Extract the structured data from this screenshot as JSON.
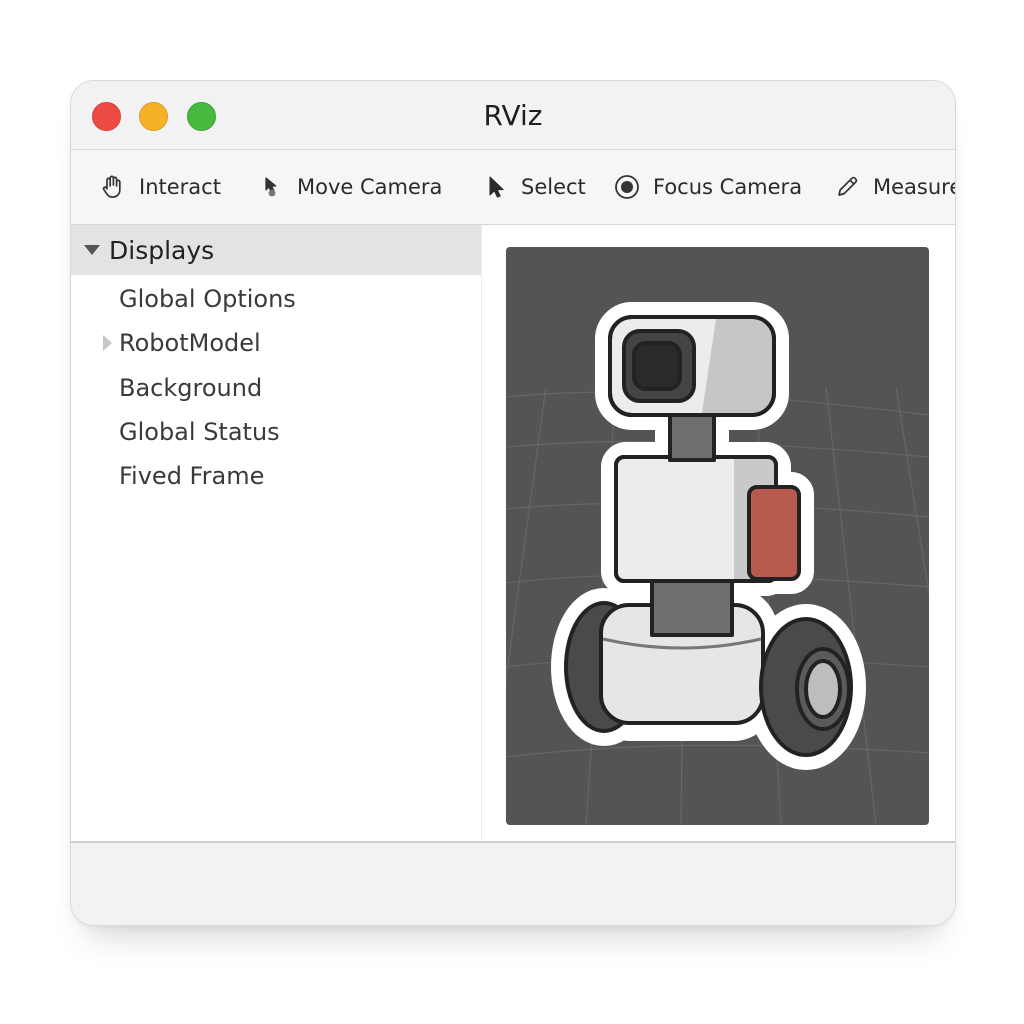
{
  "window": {
    "title": "RViz"
  },
  "toolbar": {
    "tools": [
      {
        "label": "Interact",
        "icon": "hand-icon"
      },
      {
        "label": "Move Camera",
        "icon": "move-camera-icon"
      },
      {
        "label": "Select",
        "icon": "cursor-icon"
      },
      {
        "label": "Focus Camera",
        "icon": "focus-icon"
      },
      {
        "label": "Measure",
        "icon": "pencil-icon"
      }
    ]
  },
  "sidebar": {
    "header": "Displays",
    "items": [
      {
        "label": "Global Options"
      },
      {
        "label": "RobotModel"
      },
      {
        "label": "Background"
      },
      {
        "label": "Global Status"
      },
      {
        "label": "Fived Frame"
      }
    ]
  },
  "colors": {
    "close": "#ec4b44",
    "minimize": "#f6b129",
    "maximize": "#48b93f",
    "viewport_bg": "#545454",
    "robot_accent": "#b85a4e"
  }
}
